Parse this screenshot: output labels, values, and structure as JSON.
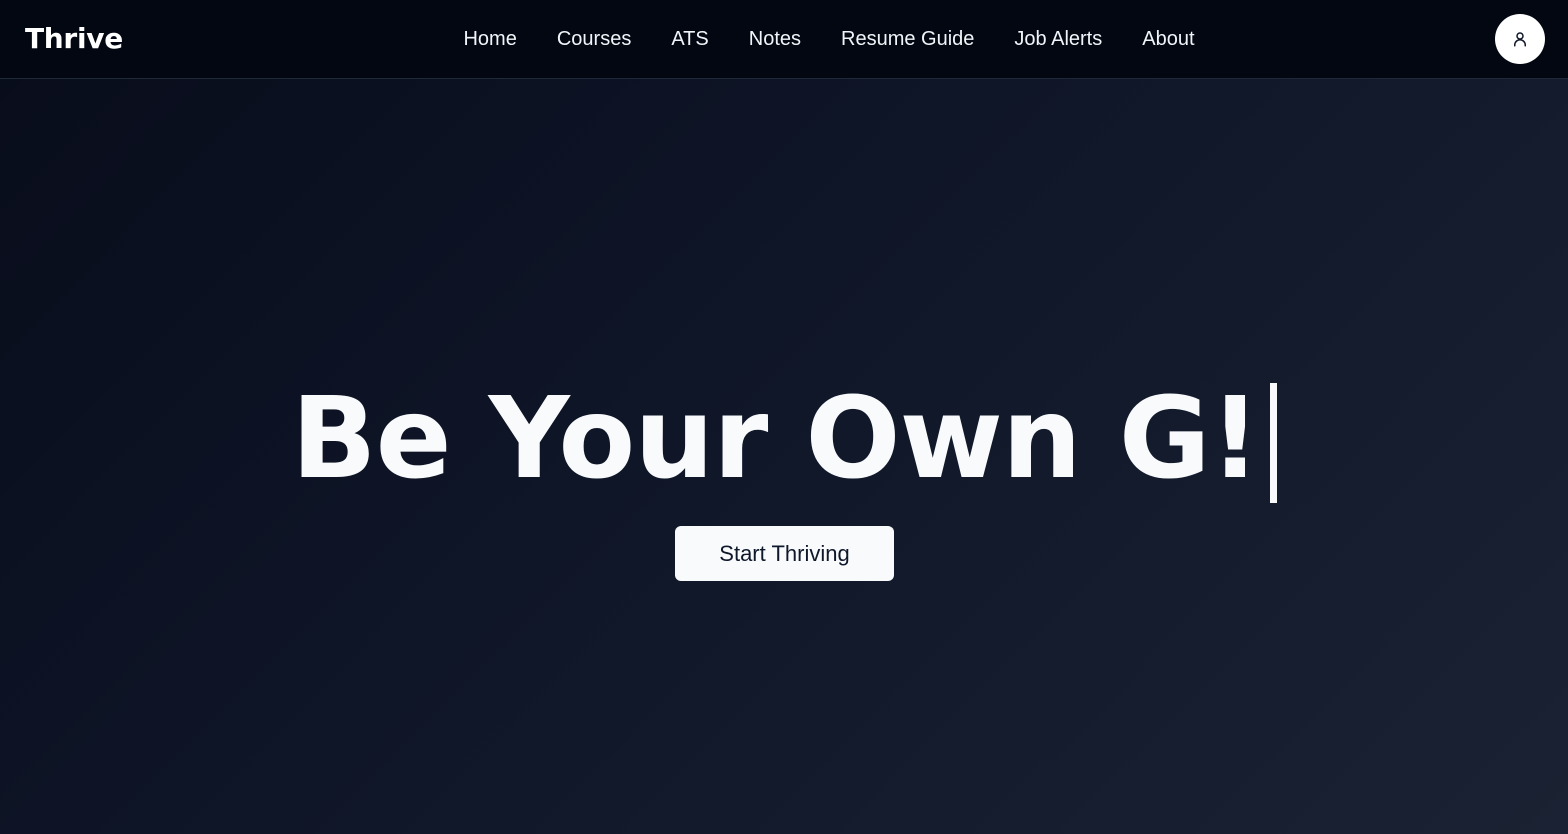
{
  "navbar": {
    "brand": "Thrive",
    "links": [
      {
        "label": "Home"
      },
      {
        "label": "Courses"
      },
      {
        "label": "ATS"
      },
      {
        "label": "Notes"
      },
      {
        "label": "Resume Guide"
      },
      {
        "label": "Job Alerts"
      },
      {
        "label": "About"
      }
    ],
    "profile_icon": "user-icon"
  },
  "hero": {
    "headline": "Be Your Own G!",
    "cta_label": "Start Thriving"
  },
  "colors": {
    "nav_bg": "#030712",
    "page_bg_start": "#080c1a",
    "page_bg_end": "#1a2233",
    "text": "#f8fafc",
    "button_bg": "#f8fafc",
    "button_text": "#0f172a"
  }
}
